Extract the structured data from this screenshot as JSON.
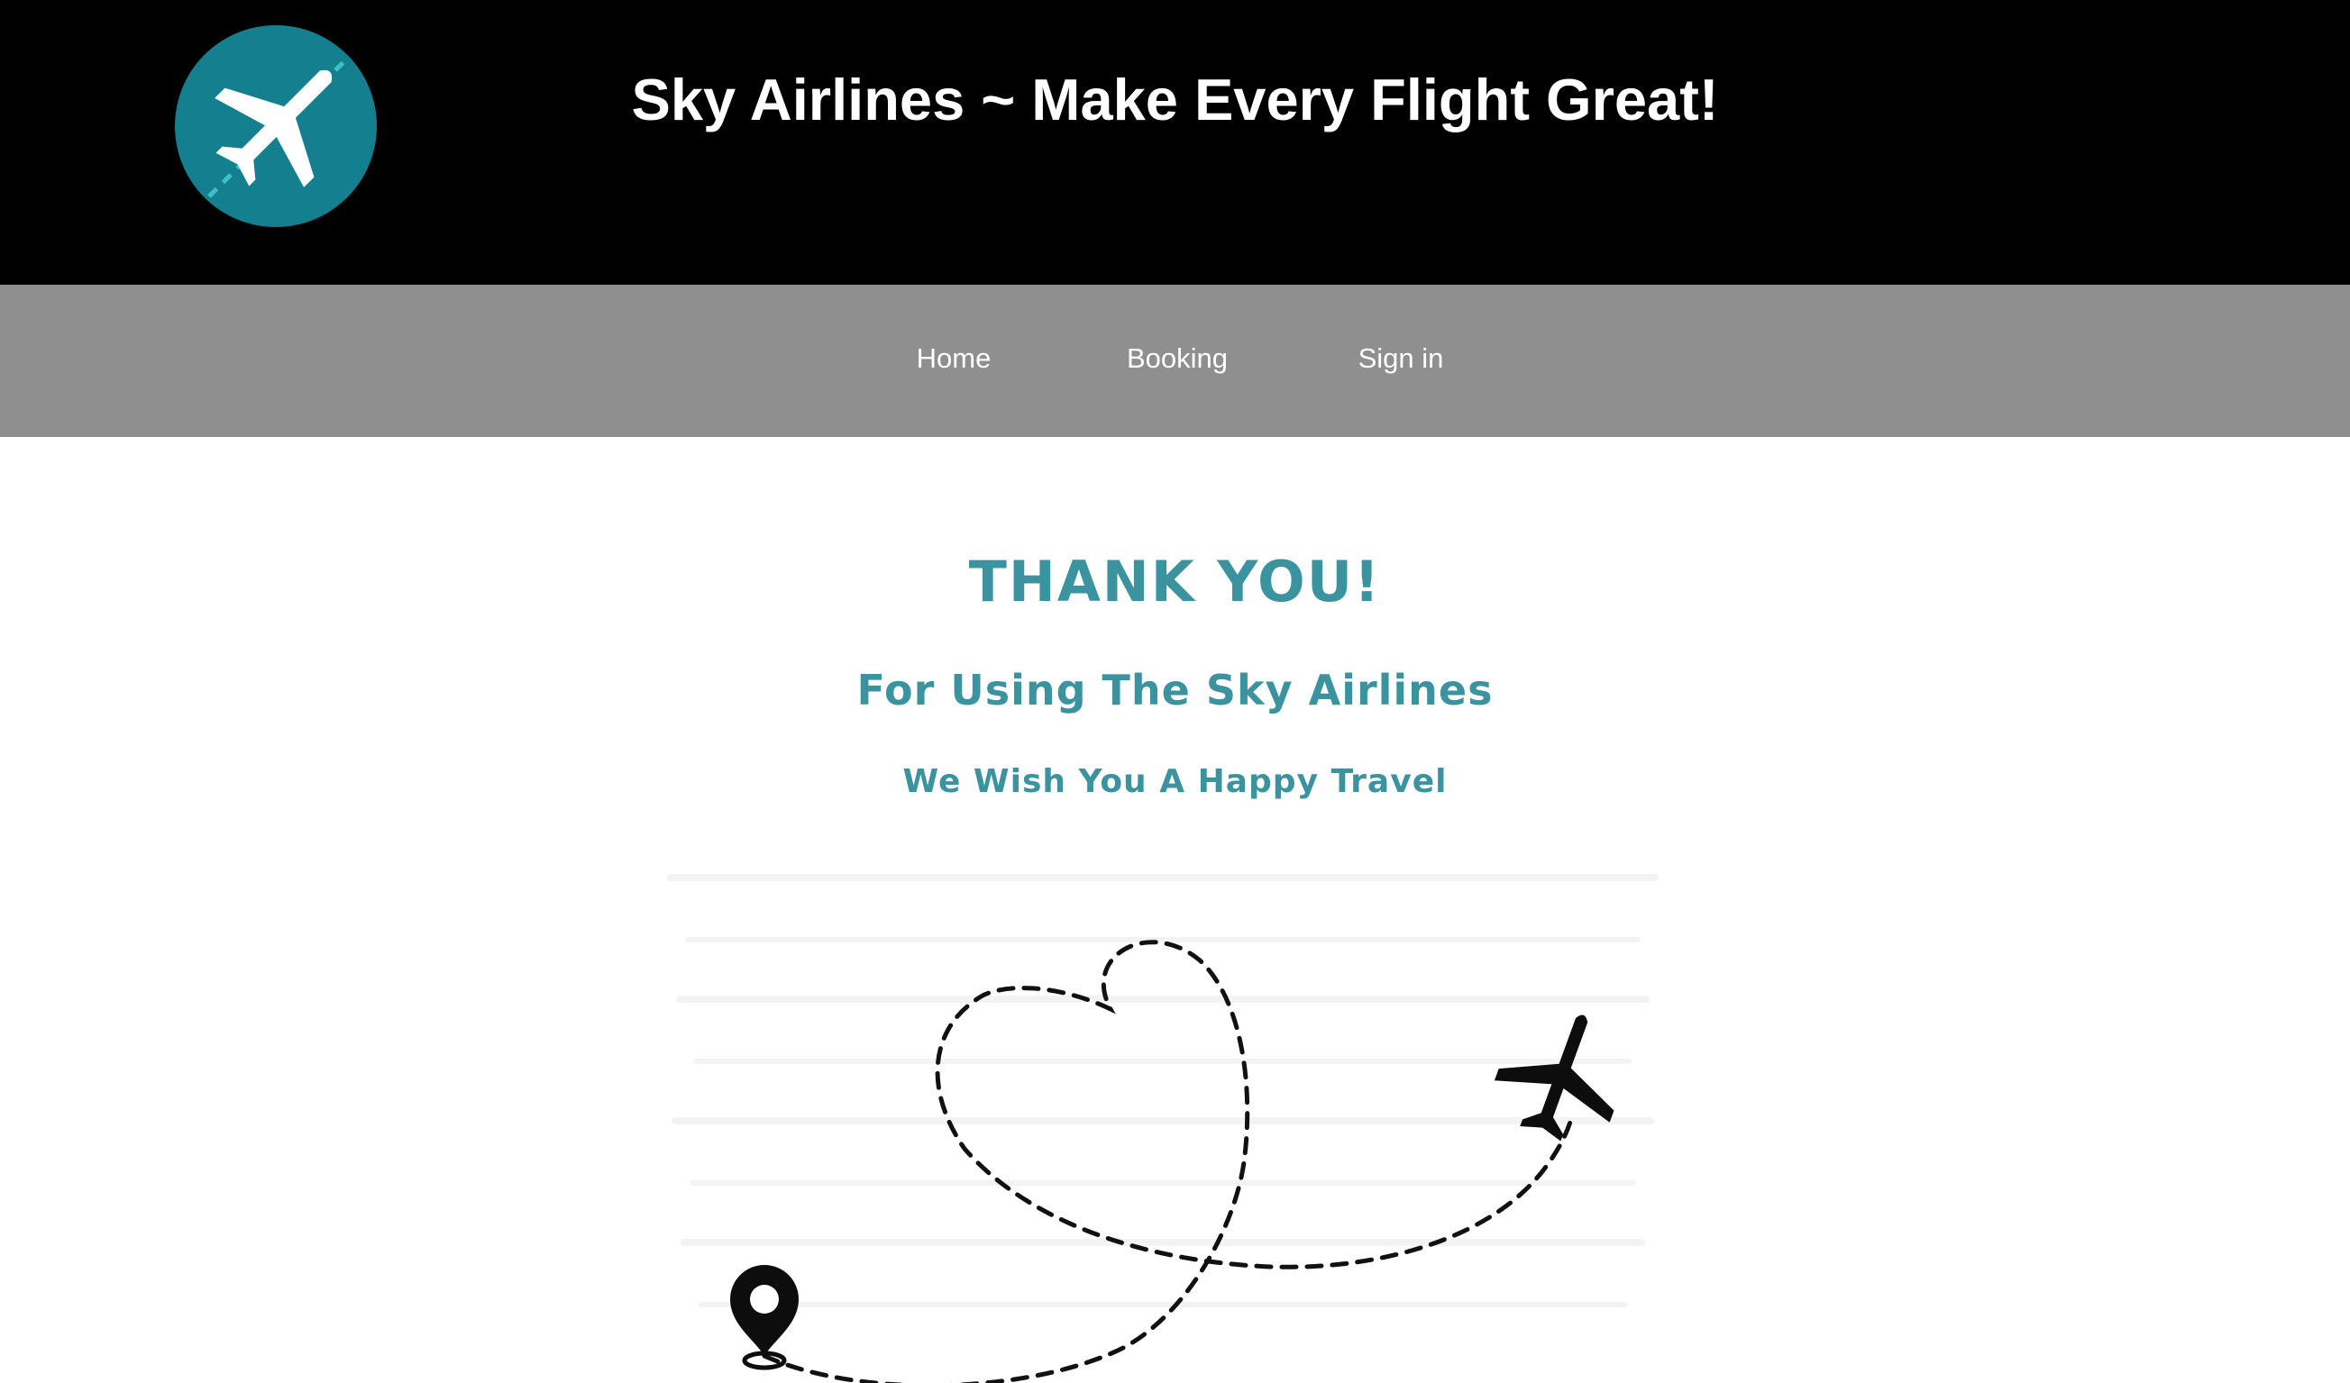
{
  "header": {
    "title": "Sky Airlines ~ Make Every Flight Great!",
    "logo_icon": "airplane-icon",
    "background_color": "#000000",
    "logo_color": "#14808f"
  },
  "nav": {
    "items": [
      {
        "label": "Home"
      },
      {
        "label": "Booking"
      },
      {
        "label": "Sign in"
      }
    ],
    "background_color": "#8f8f8f"
  },
  "main": {
    "heading": "THANK YOU!",
    "subheading": "For Using The Sky Airlines",
    "message": "We Wish You A Happy Travel",
    "text_color": "#3b93a0",
    "illustration_icons": [
      "location-pin-icon",
      "heart-flight-path-icon",
      "airplane-icon"
    ]
  }
}
